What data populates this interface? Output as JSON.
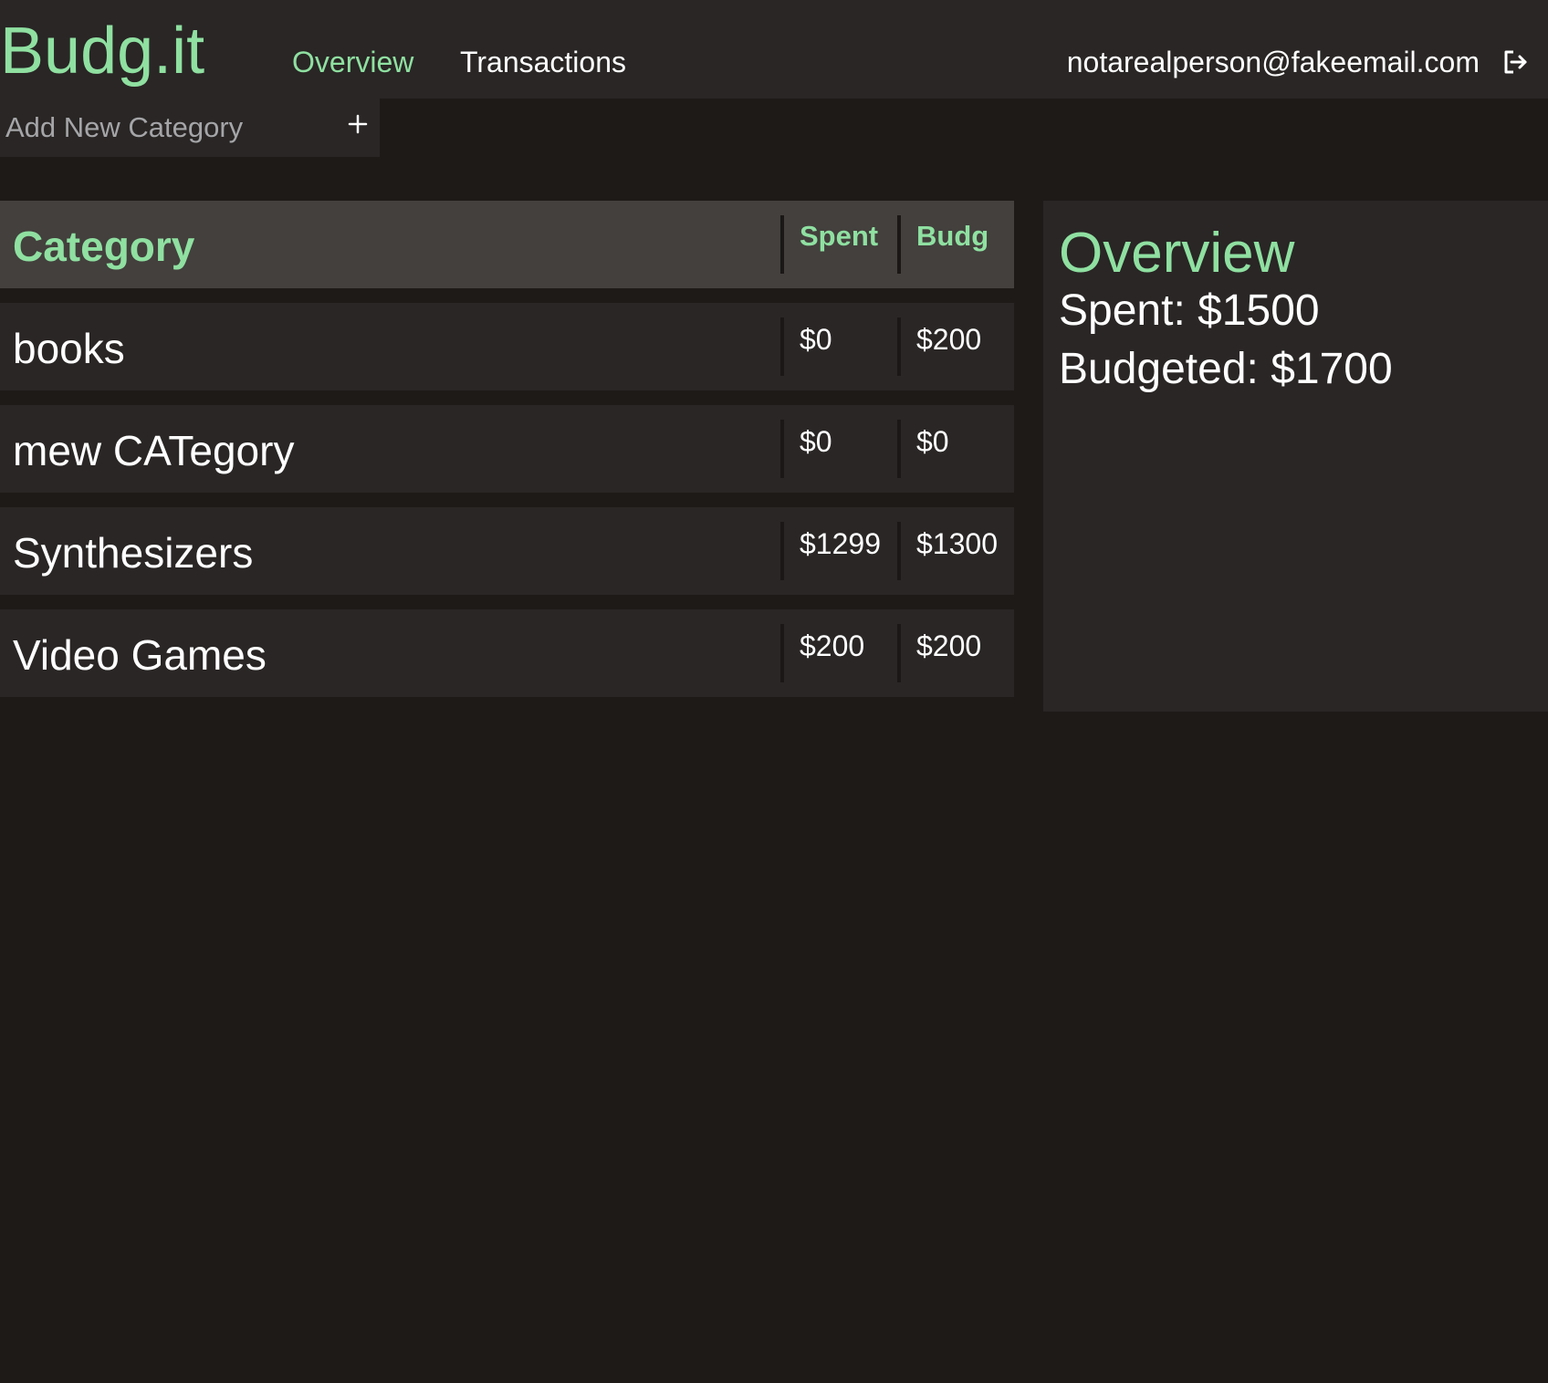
{
  "app": {
    "logo": "Budg.it"
  },
  "nav": {
    "overview": "Overview",
    "transactions": "Transactions"
  },
  "user": {
    "email": "notarealperson@fakeemail.com",
    "logout_icon": "logout-icon"
  },
  "add_category": {
    "placeholder": "Add New Category",
    "plus_icon": "plus-icon"
  },
  "table": {
    "headers": {
      "category": "Category",
      "spent": "Spent",
      "budgeted": "Budg"
    },
    "rows": [
      {
        "name": "books",
        "spent": "$0",
        "budgeted": "$200"
      },
      {
        "name": "mew CATegory",
        "spent": "$0",
        "budgeted": "$0"
      },
      {
        "name": "Synthesizers",
        "spent": "$1299",
        "budgeted": "$1300"
      },
      {
        "name": "Video Games",
        "spent": "$200",
        "budgeted": "$200"
      }
    ]
  },
  "overview": {
    "title": "Overview",
    "spent": "Spent: $1500",
    "budgeted": "Budgeted: $1700"
  },
  "colors": {
    "accent": "#8fe0a1",
    "background": "#1e1a18",
    "panel": "#292625",
    "table_header": "#43403d"
  }
}
